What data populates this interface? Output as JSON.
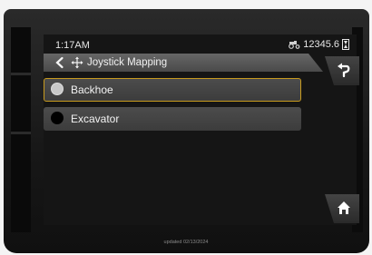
{
  "status": {
    "time": "1:17AM",
    "odometer": "12345.6"
  },
  "header": {
    "title": "Joystick Mapping"
  },
  "options": [
    {
      "label": "Backhoe",
      "selected": true
    },
    {
      "label": "Excavator",
      "selected": false
    }
  ],
  "footer": {
    "text": "updated 02/13/2024"
  },
  "colors": {
    "selection_border": "#c79a1e",
    "title_bar": "#555555",
    "screen_bg": "#151515"
  },
  "icons": {
    "back": "chevron-left-icon",
    "title": "move-arrows-icon",
    "undo": "undo-arrow-icon",
    "home": "home-icon",
    "odometer": "tractor-icon",
    "hour_meter": "hourglass-icon"
  }
}
